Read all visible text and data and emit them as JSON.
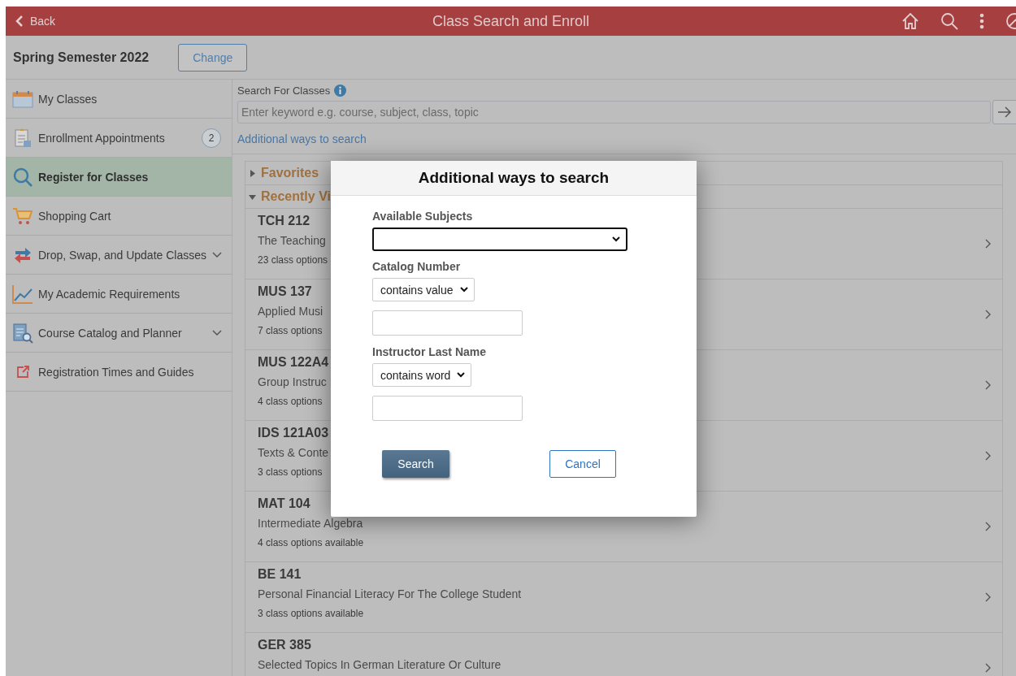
{
  "header": {
    "back": "Back",
    "title": "Class Search and Enroll"
  },
  "term": {
    "label": "Spring Semester 2022",
    "button": "Change"
  },
  "sidebar": {
    "items": [
      {
        "label": "My Classes",
        "selected": false,
        "expandable": false
      },
      {
        "label": "Enrollment Appointments",
        "selected": false,
        "expandable": false,
        "badge": "2"
      },
      {
        "label": "Register for Classes",
        "selected": true,
        "expandable": false
      },
      {
        "label": "Shopping Cart",
        "selected": false,
        "expandable": false
      },
      {
        "label": "Drop, Swap, and Update Classes",
        "selected": false,
        "expandable": true
      },
      {
        "label": "My Academic Requirements",
        "selected": false,
        "expandable": false
      },
      {
        "label": "Course Catalog and Planner",
        "selected": false,
        "expandable": true
      },
      {
        "label": "Registration Times and Guides",
        "selected": false,
        "expandable": false
      }
    ]
  },
  "search": {
    "label": "Search For Classes",
    "placeholder": "Enter keyword e.g. course, subject, class, topic",
    "link": "Additional ways to search"
  },
  "sections": [
    {
      "title": "Favorites",
      "expanded": false
    },
    {
      "title": "Recently Vi",
      "expanded": true
    }
  ],
  "courses": [
    {
      "code": "TCH 212",
      "title": "The Teaching",
      "options": "23 class options"
    },
    {
      "code": "MUS 137",
      "title": "Applied Musi",
      "options": "7 class options"
    },
    {
      "code": "MUS 122A4",
      "title": "Group Instruc",
      "options": "4 class options"
    },
    {
      "code": "IDS 121A03",
      "title": "Texts & Conte",
      "options": "3 class options"
    },
    {
      "code": "MAT 104",
      "title": "Intermediate Algebra",
      "options": "4 class options available"
    },
    {
      "code": "BE 141",
      "title": "Personal Financial Literacy For The College Student",
      "options": "3 class options available"
    },
    {
      "code": "GER 385",
      "title": "Selected Topics In German Literature Or Culture"
    }
  ],
  "modal": {
    "title": "Additional ways to search",
    "subjects": {
      "label": "Available Subjects"
    },
    "catalog": {
      "label": "Catalog Number",
      "operator": "contains value"
    },
    "instructor": {
      "label": "Instructor Last Name",
      "operator": "contains word"
    },
    "buttons": {
      "search": "Search",
      "cancel": "Cancel"
    }
  }
}
